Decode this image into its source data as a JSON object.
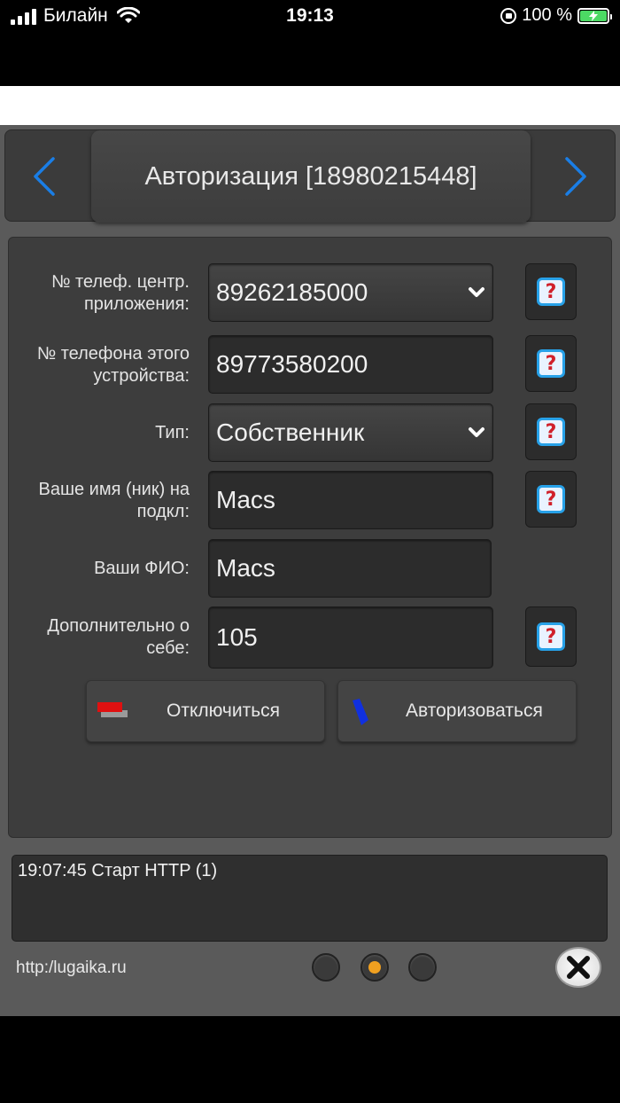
{
  "status_bar": {
    "carrier": "Билайн",
    "time": "19:13",
    "battery": "100 %"
  },
  "header": {
    "title": "Авторизация [18980215448]"
  },
  "form": {
    "rows": [
      {
        "label": "№ телеф. центр. приложения:",
        "value": "89262185000",
        "type": "select",
        "help": "?"
      },
      {
        "label": "№ телефона этого устройства:",
        "value": "89773580200",
        "type": "input",
        "help": "?"
      },
      {
        "label": "Тип:",
        "value": "Собственник",
        "type": "select",
        "help": "?"
      },
      {
        "label": "Ваше имя (ник) на подкл:",
        "value": "Macs",
        "type": "input",
        "help": "?"
      },
      {
        "label": "Ваши ФИО:",
        "value": "Macs",
        "type": "input"
      },
      {
        "label": "Дополнительно о себе:",
        "value": "105",
        "type": "input",
        "help": "?"
      }
    ]
  },
  "actions": {
    "disconnect_label": "Отключиться",
    "authorize_label": "Авторизоваться"
  },
  "log": {
    "text": "19:07:45 Старт HTTP (1)"
  },
  "footer": {
    "link": "http:/lugaika.ru",
    "pages": 3,
    "active_page": 2
  },
  "colors": {
    "accent_blue": "#1a7ee6",
    "active_dot": "#f0a020",
    "help_border": "#27a1e8"
  }
}
